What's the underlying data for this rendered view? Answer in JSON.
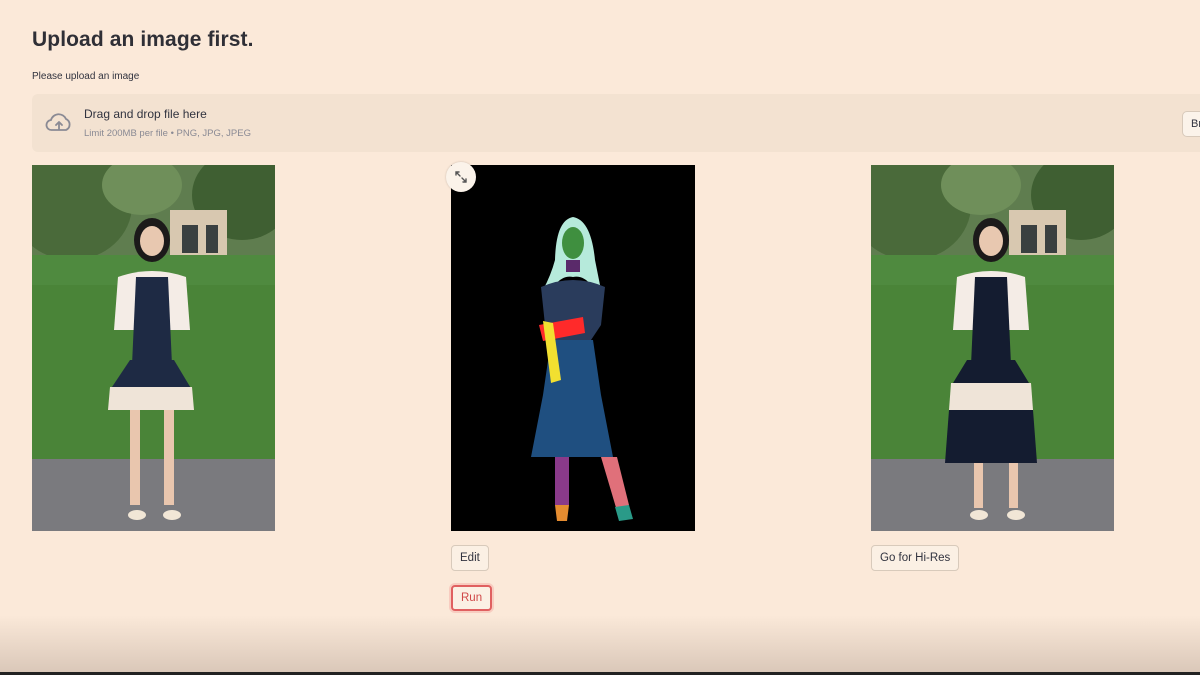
{
  "page": {
    "title": "Upload an image first."
  },
  "uploader": {
    "label": "Please upload an image",
    "drop_text": "Drag and drop file here",
    "limit_text": "Limit 200MB per file • PNG, JPG, JPEG",
    "browse_label": "Browse files",
    "icon": "cloud-upload-icon"
  },
  "images": {
    "original": "original-photo",
    "segmentation": "segmentation-map",
    "result": "result-photo"
  },
  "buttons": {
    "edit": "Edit",
    "run": "Run",
    "hires": "Go for Hi-Res"
  },
  "colors": {
    "background": "#fbe9d9",
    "dropzone": "#f3e2d1",
    "run_accent": "#e06060",
    "seg_hair": "#b6eadb",
    "seg_face": "#3f8f3f",
    "seg_dress": "#1f4f80",
    "seg_top": "#2a3c5c",
    "seg_arm": "#ff2a2a",
    "seg_bag": "#f2e030",
    "seg_left_leg": "#8a3a8a",
    "seg_right_leg": "#e0707a"
  }
}
